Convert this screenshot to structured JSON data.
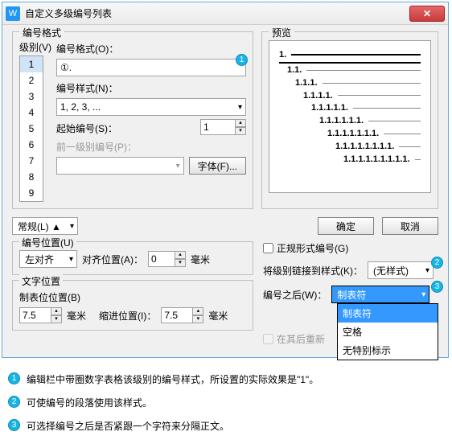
{
  "window": {
    "title": "自定义多级编号列表"
  },
  "format_group": {
    "title": "编号格式"
  },
  "preview_group": {
    "title": "预览"
  },
  "level": {
    "label": "级别(V)",
    "items": [
      "1",
      "2",
      "3",
      "4",
      "5",
      "6",
      "7",
      "8",
      "9"
    ],
    "selected": 0
  },
  "num_format": {
    "label": "编号格式(O)：",
    "value": "①."
  },
  "num_style": {
    "label": "编号样式(N)：",
    "value": "1, 2, 3, ..."
  },
  "start_at": {
    "label": "起始编号(S)：",
    "value": "1"
  },
  "prev_level": {
    "label": "前一级别编号(P)："
  },
  "font_btn": {
    "label": "字体(F)..."
  },
  "preview_lines": [
    {
      "num": "1.",
      "indent": 0,
      "thick": true
    },
    {
      "num": "",
      "indent": 0,
      "thick": true
    },
    {
      "num": "1.1.",
      "indent": 1
    },
    {
      "num": "1.1.1.",
      "indent": 2
    },
    {
      "num": "1.1.1.1.",
      "indent": 3
    },
    {
      "num": "1.1.1.1.1.",
      "indent": 4
    },
    {
      "num": "1.1.1.1.1.1.",
      "indent": 5
    },
    {
      "num": "1.1.1.1.1.1.1.",
      "indent": 6
    },
    {
      "num": "1.1.1.1.1.1.1.1.",
      "indent": 7
    },
    {
      "num": "1.1.1.1.1.1.1.1.1.",
      "indent": 8
    }
  ],
  "normal_btn": {
    "label": "常规(L) ▲"
  },
  "ok_btn": {
    "label": "确定"
  },
  "cancel_btn": {
    "label": "取消"
  },
  "pos_group": {
    "title": "编号位置(U)"
  },
  "align": {
    "value": "左对齐",
    "pos_label": "对齐位置(A)：",
    "pos_value": "0",
    "unit": "毫米"
  },
  "text_group": {
    "title": "文字位置"
  },
  "tab": {
    "label": "制表位位置(B)",
    "value": "7.5",
    "unit": "毫米",
    "indent_label": "缩进位置(I)：",
    "indent_value": "7.5",
    "indent_unit": "毫米"
  },
  "formal": {
    "label": "正规形式编号(G)"
  },
  "link_style": {
    "label": "将级别链接到样式(K)：",
    "value": "(无样式)"
  },
  "after_num": {
    "label": "编号之后(W)：",
    "value": "制表符",
    "options": [
      "制表符",
      "空格",
      "无特别标示"
    ]
  },
  "restart": {
    "label": "在其后重新"
  },
  "notes": {
    "n1": "编辑栏中带圈数字表格该级别的编号样式，所设置的实际效果是\"1\"。",
    "n2": "可使编号的段落使用该样式。",
    "n3": "可选择编号之后是否紧跟一个字符来分隔正文。"
  }
}
